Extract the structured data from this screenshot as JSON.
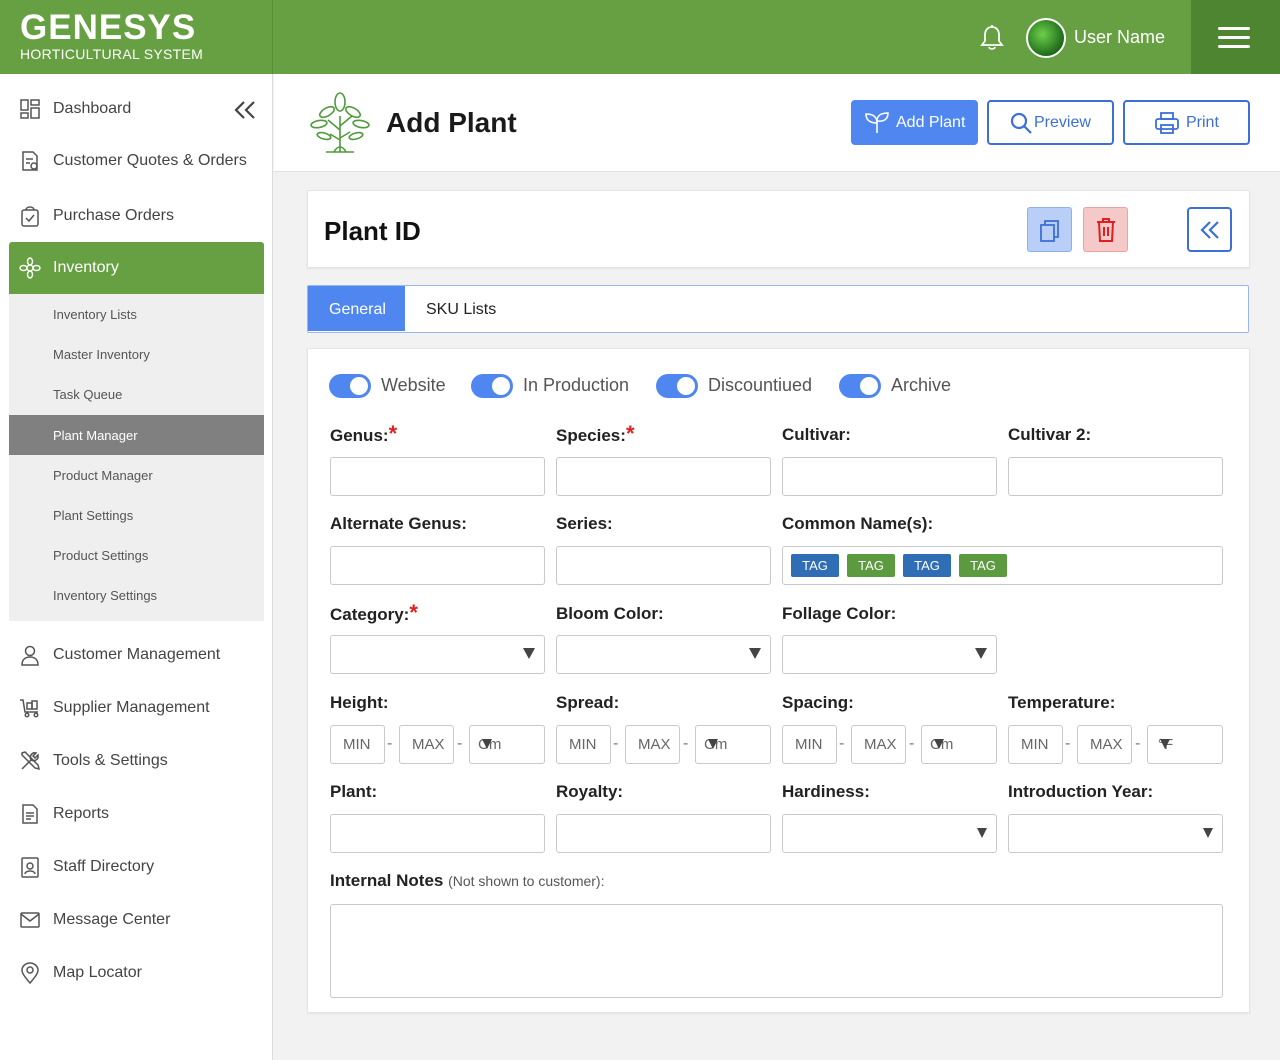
{
  "header": {
    "logo_main": "GENESYS",
    "logo_sub": "HORTICULTURAL SYSTEM",
    "user_name": "User Name"
  },
  "sidebar": {
    "items": [
      {
        "label": "Dashboard",
        "icon": "dashboard-icon"
      },
      {
        "label": "Customer Quotes & Orders",
        "icon": "quotes-icon"
      },
      {
        "label": "Purchase Orders",
        "icon": "purchase-orders-icon"
      },
      {
        "label": "Inventory",
        "icon": "inventory-icon"
      },
      {
        "label": "Customer Management",
        "icon": "customer-icon"
      },
      {
        "label": "Supplier Management",
        "icon": "supplier-icon"
      },
      {
        "label": "Tools & Settings",
        "icon": "tools-icon"
      },
      {
        "label": "Reports",
        "icon": "reports-icon"
      },
      {
        "label": "Staff Directory",
        "icon": "staff-icon"
      },
      {
        "label": "Message Center",
        "icon": "message-icon"
      },
      {
        "label": "Map Locator",
        "icon": "map-pin-icon"
      }
    ],
    "inventory_sub": [
      "Inventory Lists",
      "Master Inventory",
      "Task Queue",
      "Plant Manager",
      "Product Manager",
      "Plant Settings",
      "Product Settings",
      "Inventory Settings"
    ],
    "selected_sub": "Plant Manager"
  },
  "page": {
    "title": "Add Plant",
    "buttons": {
      "add_plant": "Add Plant",
      "preview": "Preview",
      "print": "Print"
    }
  },
  "plant_card": {
    "title": "Plant ID"
  },
  "tabs": {
    "general": "General",
    "sku_lists": "SKU Lists",
    "active": "General"
  },
  "toggles": [
    {
      "label": "Website",
      "on": true
    },
    {
      "label": "In Production",
      "on": true
    },
    {
      "label": "Discountiued",
      "on": true
    },
    {
      "label": "Archive",
      "on": true
    }
  ],
  "form": {
    "genus": "Genus:",
    "species": "Species:",
    "cultivar": "Cultivar:",
    "cultivar2": "Cultivar 2:",
    "alternate_genus": "Alternate Genus:",
    "series": "Series:",
    "common_names": "Common Name(s):",
    "category": "Category:",
    "bloom_color": "Bloom Color:",
    "foliage_color": "Follage Color:",
    "height": "Height:",
    "spread": "Spread:",
    "spacing": "Spacing:",
    "temperature": "Temperature:",
    "plant": "Plant:",
    "royalty": "Royalty:",
    "hardiness": "Hardiness:",
    "intro_year": "Introduction Year:",
    "internal_notes": "Internal Notes",
    "internal_notes_sub": "(Not shown to customer):",
    "required_mark": "*",
    "min": "MIN",
    "max": "MAX",
    "dash": "-",
    "unit_cm": "Cm",
    "unit_f": "°F",
    "tags": [
      "TAG",
      "TAG",
      "TAG",
      "TAG"
    ]
  },
  "colors": {
    "brand_green": "#66a043",
    "accent_blue": "#4f86f0",
    "danger_red": "#e02020"
  }
}
